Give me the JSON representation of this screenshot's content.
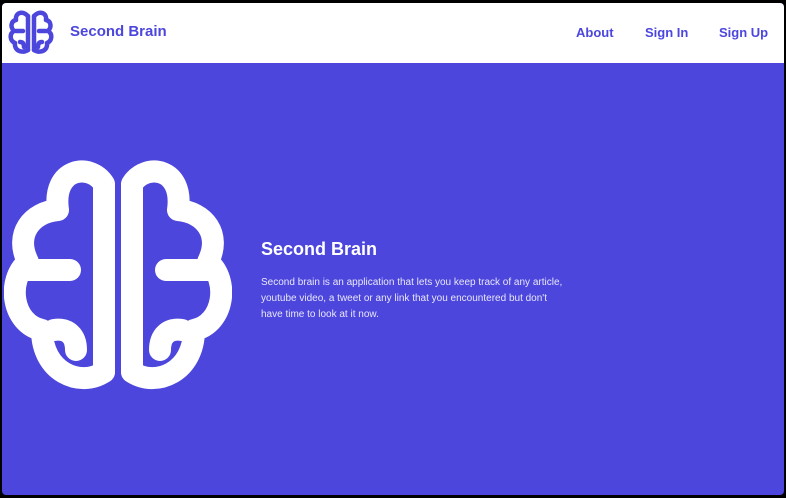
{
  "header": {
    "brand": "Second Brain",
    "logo_icon": "brain-icon",
    "nav": [
      {
        "label": "About"
      },
      {
        "label": "Sign In"
      },
      {
        "label": "Sign Up"
      }
    ]
  },
  "hero": {
    "illustration_icon": "brain-icon",
    "title": "Second Brain",
    "description": "Second brain is an application that lets you keep track of any article, youtube video, a tweet or any link that you encountered but don't have time to look at it now."
  },
  "colors": {
    "accent": "#4c46dc",
    "background": "#4c46dc",
    "header_bg": "#ffffff",
    "text_on_accent": "#ffffff"
  }
}
